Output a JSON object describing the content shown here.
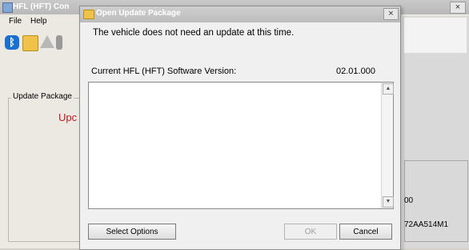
{
  "main_window": {
    "title": "HFL (HFT) Con",
    "close_glyph": "×",
    "menu": [
      "File",
      "Help"
    ],
    "group_label": "Update Package",
    "status_text": "Upc",
    "right_value_1": "00",
    "right_value_2": "72AA514M1"
  },
  "dialog": {
    "title": "Open Update Package",
    "close_glyph": "×",
    "message": "The vehicle does not need an update at this time.",
    "version_label": "Current HFL (HFT) Software Version:",
    "version_value": "02.01.000",
    "notes_text": "",
    "buttons": {
      "select_options": "Select Options",
      "ok": "OK",
      "cancel": "Cancel"
    }
  },
  "colors": {
    "status_red": "#c0171d",
    "titlebar": "#bcbcbc",
    "dialog_bg": "#f0f0f0"
  },
  "icons": [
    "bluetooth-icon",
    "folder-icon",
    "warning-icon",
    "gear-icon"
  ]
}
